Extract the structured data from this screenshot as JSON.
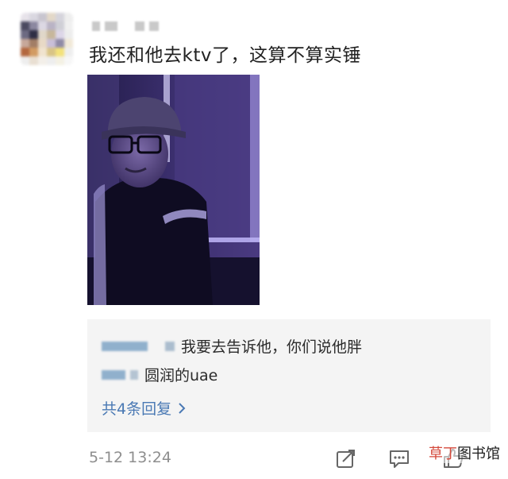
{
  "post": {
    "text": "我还和他去ktv了，这算不算实锤",
    "timestamp": "5-12 13:24"
  },
  "replies": {
    "items": [
      {
        "text": "我要去告诉他，你们说他胖"
      },
      {
        "text": "圆润的uae"
      }
    ],
    "more_label": "共4条回复"
  },
  "actions": {
    "icons": [
      "share-icon",
      "comment-icon",
      "like-icon"
    ]
  },
  "watermark": {
    "accent": "草丁",
    "rest": "图书馆"
  },
  "colors": {
    "link": "#4a79b4",
    "reply_background": "#f4f4f4",
    "timestamp": "#8e8e8e",
    "watermark_accent": "#d4493b"
  }
}
